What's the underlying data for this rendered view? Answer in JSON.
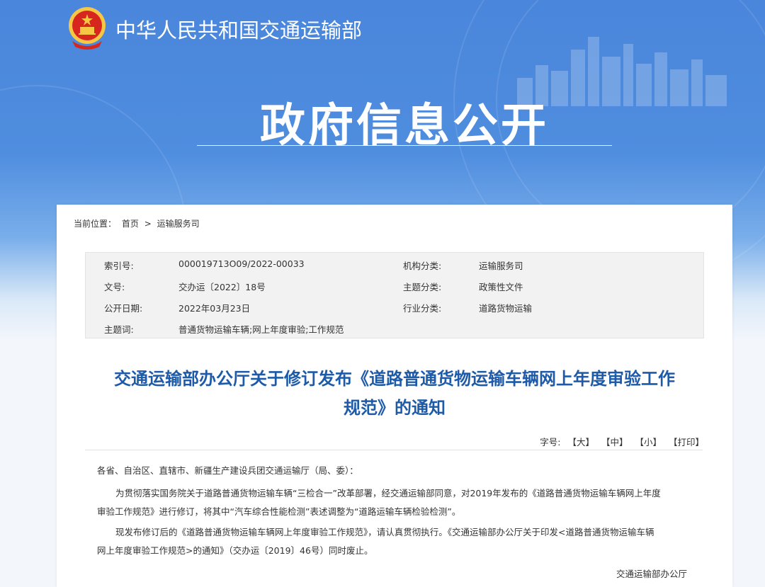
{
  "header": {
    "site_name": "中华人民共和国交通运输部",
    "section_title": "政府信息公开"
  },
  "breadcrumb": {
    "label": "当前位置：",
    "home": "首页",
    "separator": ">",
    "current": "运输服务司"
  },
  "meta": {
    "index_label": "索引号:",
    "index_value": "000019713O09/2022-00033",
    "org_label": "机构分类:",
    "org_value": "运输服务司",
    "docno_label": "文号:",
    "docno_value": "交办运〔2022〕18号",
    "topic_label": "主题分类:",
    "topic_value": "政策性文件",
    "date_label": "公开日期:",
    "date_value": "2022年03月23日",
    "industry_label": "行业分类:",
    "industry_value": "道路货物运输",
    "keywords_label": "主题词:",
    "keywords_value": "普通货物运输车辆;网上年度审验;工作规范"
  },
  "document": {
    "title_line1": "交通运输部办公厅关于修订发布《道路普通货物运输车辆网上年度审验工作",
    "title_line2": "规范》的通知",
    "salutation": "各省、自治区、直辖市、新疆生产建设兵团交通运输厅（局、委）：",
    "para1_line1": "为贯彻落实国务院关于道路普通货物运输车辆“三检合一”改革部署，经交通运输部同意，对2019年发布的《道路普通货物运输车辆网上年度",
    "para1_line2": "审验工作规范》进行修订，将其中“汽车综合性能检测”表述调整为“道路运输车辆检验检测”。",
    "para2_line1": "现发布修订后的《道路普通货物运输车辆网上年度审验工作规范》，请认真贯彻执行。《交通运输部办公厅关于印发<道路普通货物运输车辆",
    "para2_line2": "网上年度审验工作规范>的通知》（交办运〔2019〕46号）同时废止。",
    "signature": "交通运输部办公厅"
  },
  "font_tools": {
    "label": "字号:",
    "large": "【大】",
    "medium": "【中】",
    "small": "【小】",
    "print": "【打印】"
  },
  "colors": {
    "banner": "#4a86db",
    "title": "#1d5aa8",
    "emblem_red": "#d7261e",
    "emblem_gold": "#f6c744"
  }
}
